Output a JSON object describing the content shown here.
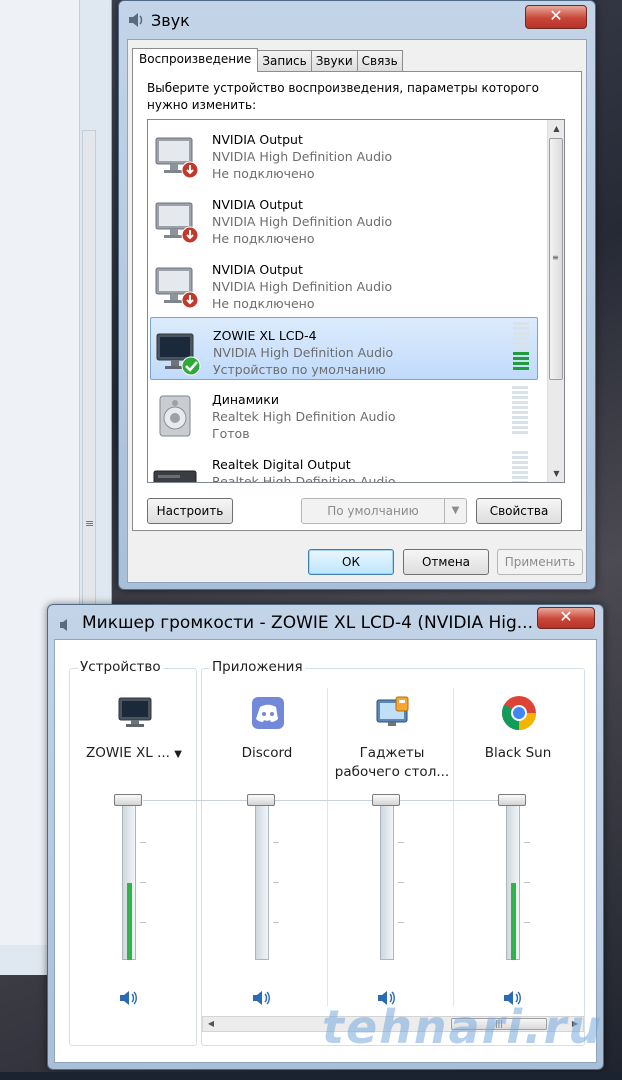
{
  "sound": {
    "title": "Звук",
    "close_label": "✕",
    "tabs": [
      {
        "label": "Воспроизведение"
      },
      {
        "label": "Запись"
      },
      {
        "label": "Звуки"
      },
      {
        "label": "Связь"
      }
    ],
    "instruction": "Выберите устройство воспроизведения, параметры которого нужно изменить:",
    "devices": [
      {
        "name": "NVIDIA Output",
        "driver": "NVIDIA High Definition Audio",
        "status": "Не подключено",
        "icon": "monitor-disconnected-icon"
      },
      {
        "name": "NVIDIA Output",
        "driver": "NVIDIA High Definition Audio",
        "status": "Не подключено",
        "icon": "monitor-disconnected-icon"
      },
      {
        "name": "NVIDIA Output",
        "driver": "NVIDIA High Definition Audio",
        "status": "Не подключено",
        "icon": "monitor-disconnected-icon"
      },
      {
        "name": "ZOWIE XL LCD-4",
        "driver": "NVIDIA High Definition Audio",
        "status": "Устройство по умолчанию",
        "icon": "monitor-default-icon",
        "selected": true,
        "meter_on": 4
      },
      {
        "name": "Динамики",
        "driver": "Realtek High Definition Audio",
        "status": "Готов",
        "icon": "speaker-icon",
        "meter_on": 0
      },
      {
        "name": "Realtek Digital Output",
        "driver": "Realtek High Definition Audio",
        "status": "",
        "icon": "digital-output-icon",
        "meter_on": 0
      }
    ],
    "buttons": {
      "configure": "Настроить",
      "set_default": "По умолчанию",
      "properties": "Свойства",
      "ok": "ОК",
      "cancel": "Отмена",
      "apply": "Применить"
    }
  },
  "mixer": {
    "title": "Микшер громкости - ZOWIE XL LCD-4 (NVIDIA Hig...",
    "close_label": "✕",
    "device_group": "Устройство",
    "apps_group": "Приложения",
    "channels": [
      {
        "name": "ZOWIE XL ...",
        "volume_percent": 100,
        "level_percent": 48,
        "icon": "monitor-icon",
        "has_dropdown": true
      },
      {
        "name": "Discord",
        "volume_percent": 100,
        "level_percent": 0,
        "icon": "discord-icon"
      },
      {
        "name": "Гаджеты рабочего стол...",
        "volume_percent": 100,
        "level_percent": 0,
        "icon": "desktop-gadgets-icon"
      },
      {
        "name": "Black Sun",
        "volume_percent": 100,
        "level_percent": 48,
        "icon": "chrome-icon"
      }
    ]
  },
  "watermark": "tehnari.ru"
}
